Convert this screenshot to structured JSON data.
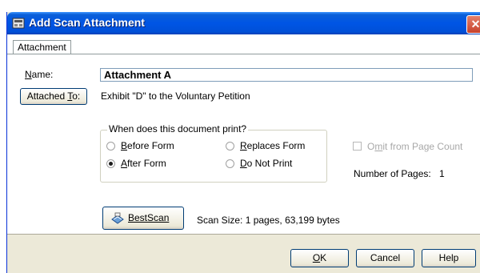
{
  "window": {
    "title": "Add Scan Attachment",
    "close_glyph": "✕"
  },
  "tabs": [
    {
      "label": "Attachment",
      "selected": true
    }
  ],
  "name": {
    "label_first": "N",
    "label_rest": "ame:",
    "value": "Attachment A"
  },
  "attached_to": {
    "button_pre": "Attached ",
    "button_key": "T",
    "button_post": "o:",
    "value": "Exhibit \"D\" to the Voluntary Petition"
  },
  "print_group": {
    "legend": "When does this document print?",
    "options": [
      {
        "key": "B",
        "rest": "efore Form",
        "checked": false
      },
      {
        "key": "A",
        "rest": "fter Form",
        "checked": true
      },
      {
        "key": "R",
        "rest": "eplaces Form",
        "checked": false
      },
      {
        "key": "D",
        "rest": "o Not Print",
        "checked": false
      }
    ]
  },
  "omit": {
    "pre": "O",
    "key": "m",
    "post": "it from Page Count",
    "checked": false,
    "enabled": false
  },
  "pages": {
    "label": "Number of Pages:",
    "value": "1"
  },
  "scan_button": {
    "label": "BestScan",
    "icon": "scanner-icon"
  },
  "scan_size": "Scan Size: 1 pages, 63,199 bytes",
  "footer": {
    "ok_key": "O",
    "ok_rest": "K",
    "cancel": "Cancel",
    "help": "Help"
  },
  "colors": {
    "titlebar": "#0055e5",
    "dialog_bg": "#ece9d8",
    "panel_bg": "#ffffff"
  }
}
